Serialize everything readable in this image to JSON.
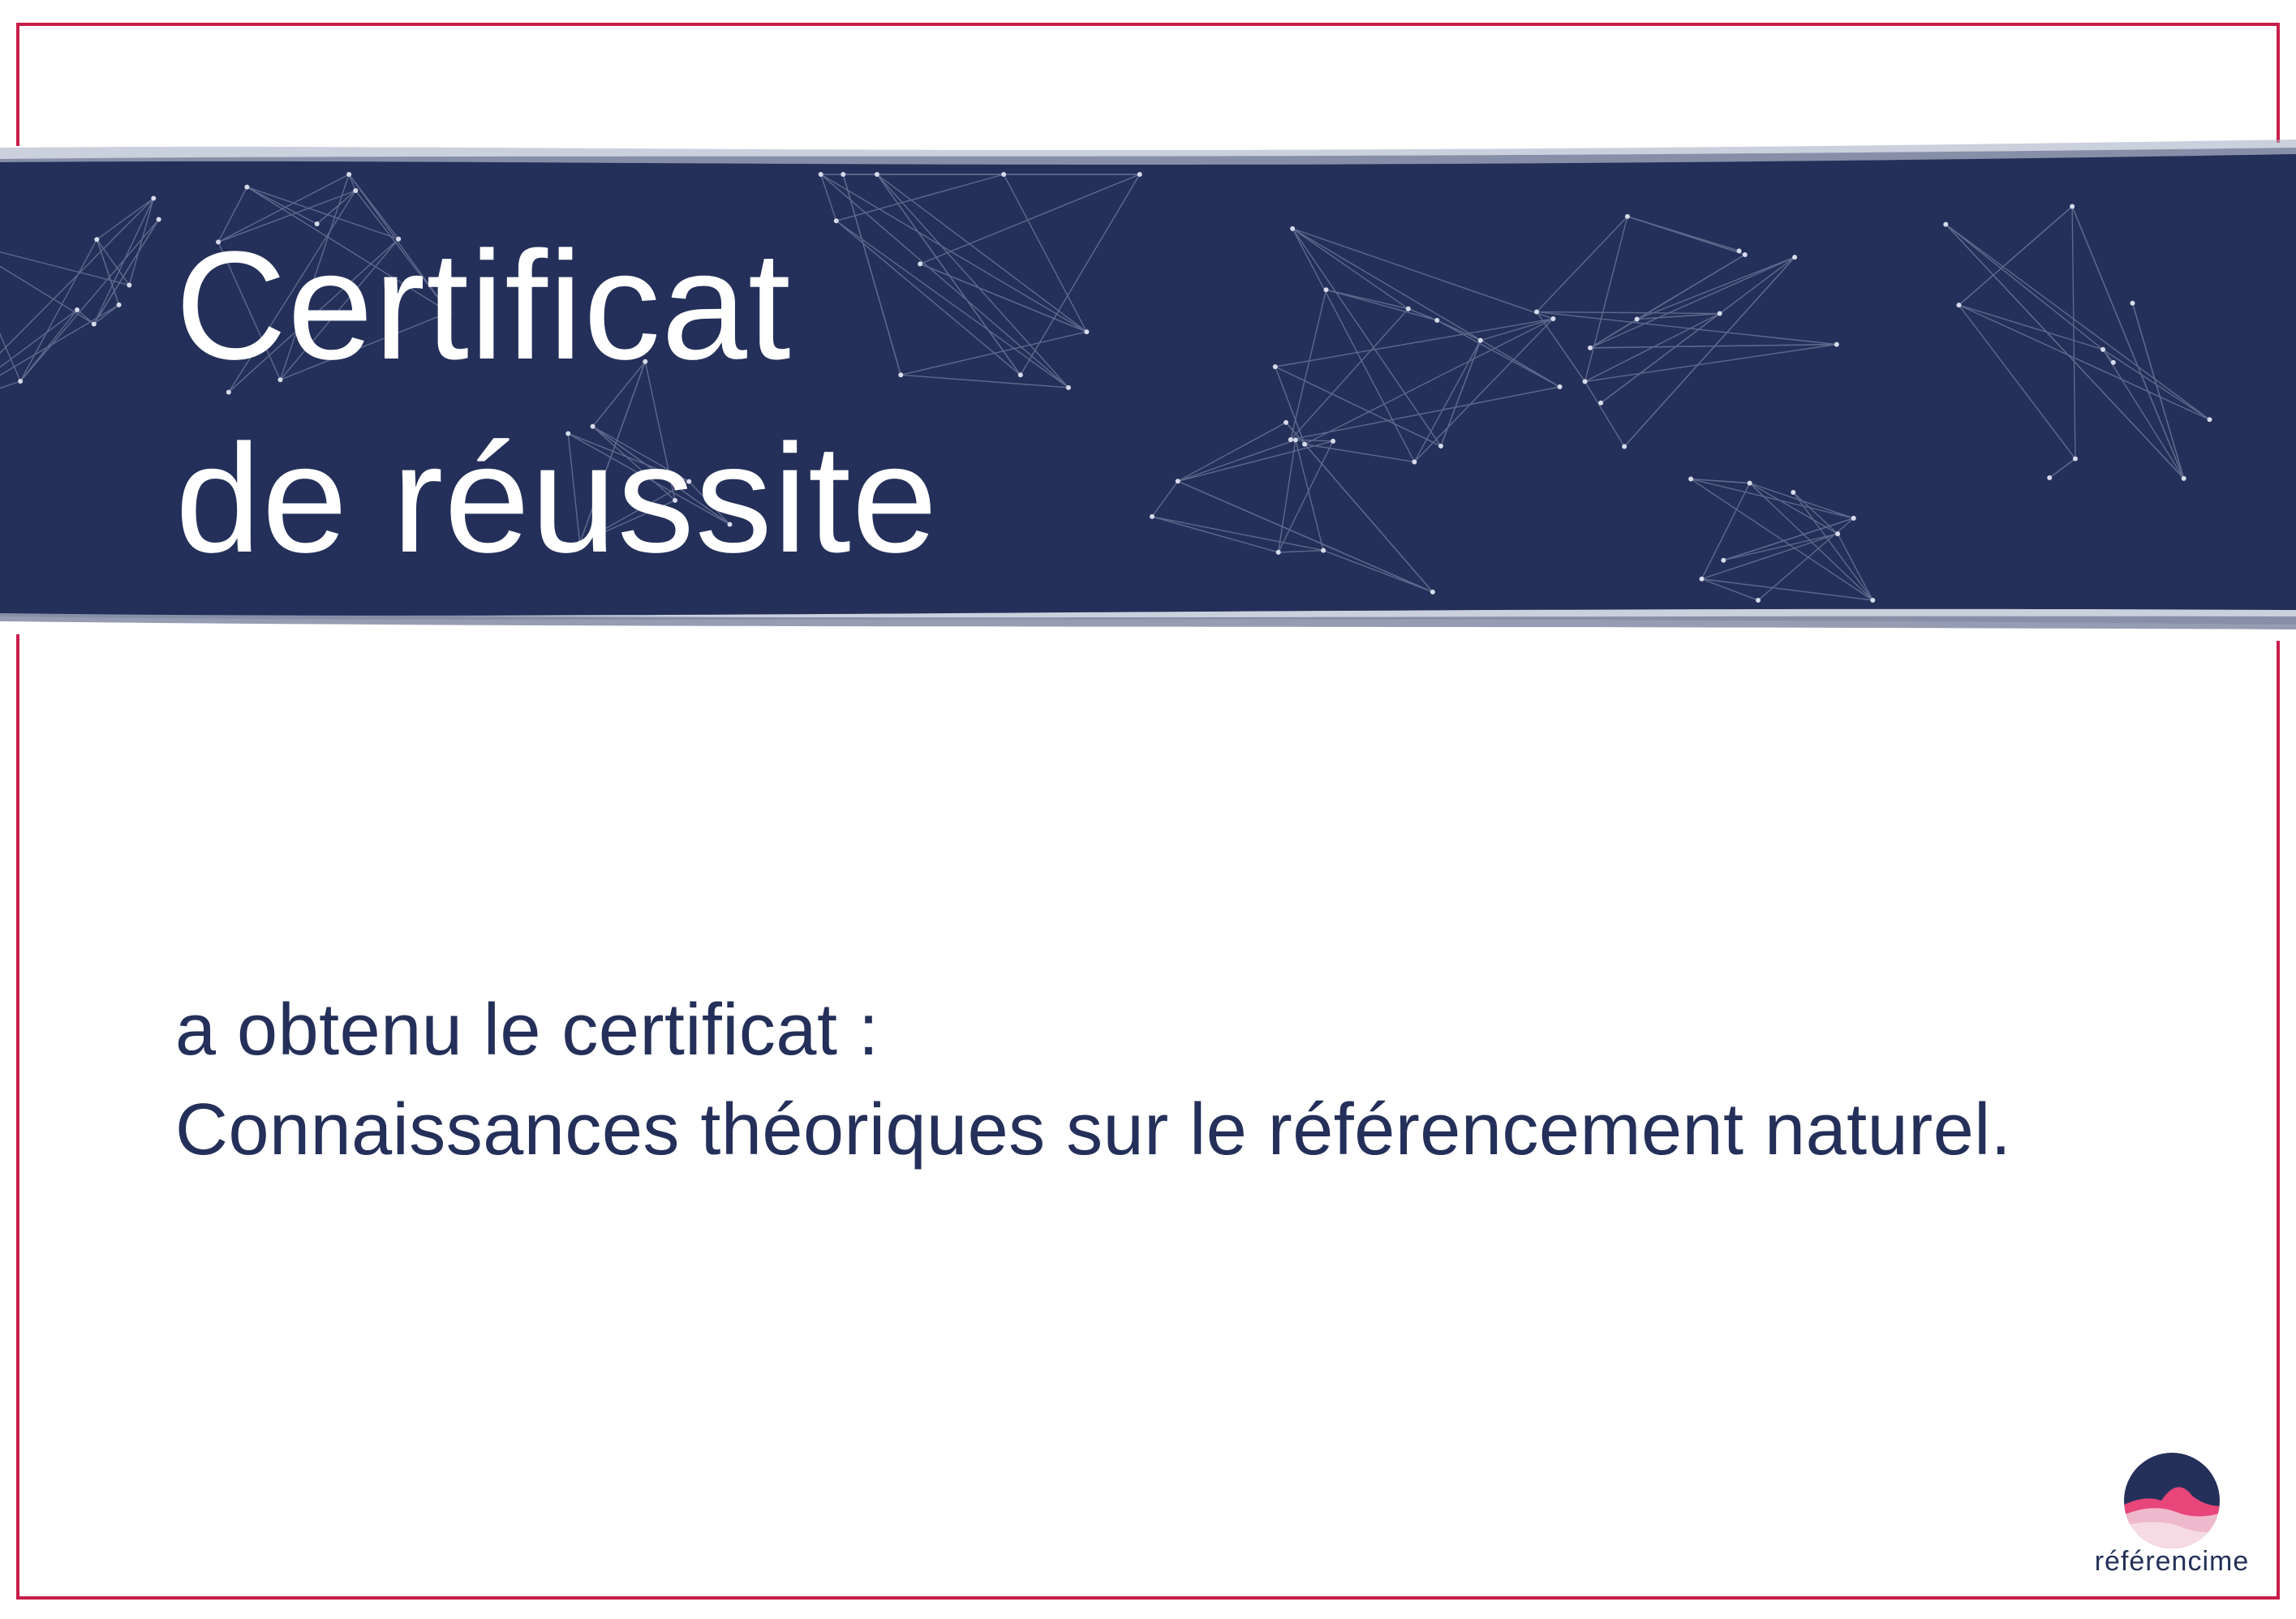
{
  "certificate": {
    "title_line1": "Certificat",
    "title_line2": "de réussite",
    "subtitle": "a obtenu le certificat :",
    "course": "Connaissances théoriques sur le référencement naturel."
  },
  "brand": {
    "name": "référencime",
    "logo_icon": "mountain-waves-circle-icon"
  },
  "colors": {
    "banner": "#243059",
    "frame": "#c81e4b",
    "text": "#243059",
    "logo_pink": "#e8457a",
    "logo_light_pink": "#eeb9cc"
  }
}
